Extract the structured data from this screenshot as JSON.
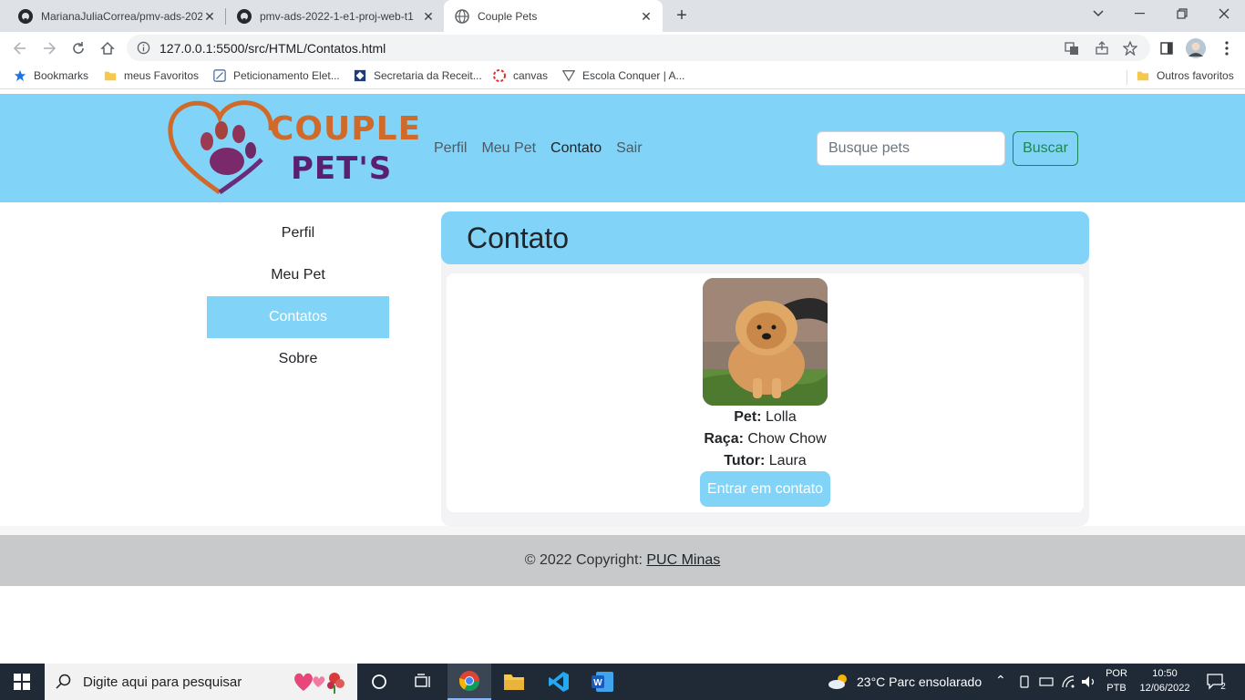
{
  "browser": {
    "tabs": [
      {
        "title": "MarianaJuliaCorrea/pmv-ads-202",
        "active": false
      },
      {
        "title": "pmv-ads-2022-1-e1-proj-web-t1",
        "active": false
      },
      {
        "title": "Couple Pets",
        "active": true
      }
    ],
    "url": "127.0.0.1:5500/src/HTML/Contatos.html",
    "bookmarks": [
      {
        "label": "Bookmarks",
        "icon": "star-icon"
      },
      {
        "label": "meus Favoritos",
        "icon": "folder-icon"
      },
      {
        "label": "Peticionamento Elet...",
        "icon": "site-icon"
      },
      {
        "label": "Secretaria da Receit...",
        "icon": "site-icon"
      },
      {
        "label": "canvas",
        "icon": "site-icon"
      },
      {
        "label": "Escola Conquer | A...",
        "icon": "site-icon"
      }
    ],
    "other_bookmarks": "Outros favoritos"
  },
  "site": {
    "logo": {
      "line1": "COUPLE",
      "line2": "PET'S"
    },
    "nav": [
      "Perfil",
      "Meu Pet",
      "Contato",
      "Sair"
    ],
    "nav_active": "Contato",
    "search_placeholder": "Busque pets",
    "search_button": "Buscar",
    "sidebar": [
      "Perfil",
      "Meu Pet",
      "Contatos",
      "Sobre"
    ],
    "sidebar_active": "Contatos",
    "content_title": "Contato",
    "contact": {
      "pet_label": "Pet:",
      "pet": "Lolla",
      "breed_label": "Raça:",
      "breed": "Chow Chow",
      "tutor_label": "Tutor:",
      "tutor": "Laura",
      "button": "Entrar em contato"
    },
    "footer": {
      "text": "© 2022 Copyright: ",
      "link": "PUC Minas"
    },
    "colors": {
      "accent": "#81d4f7",
      "success": "#198754"
    }
  },
  "taskbar": {
    "search_placeholder": "Digite aqui para pesquisar",
    "weather": "23°C  Parc ensolarado",
    "lang_line1": "POR",
    "lang_line2": "PTB",
    "time": "10:50",
    "date": "12/06/2022",
    "notifications": "2"
  }
}
